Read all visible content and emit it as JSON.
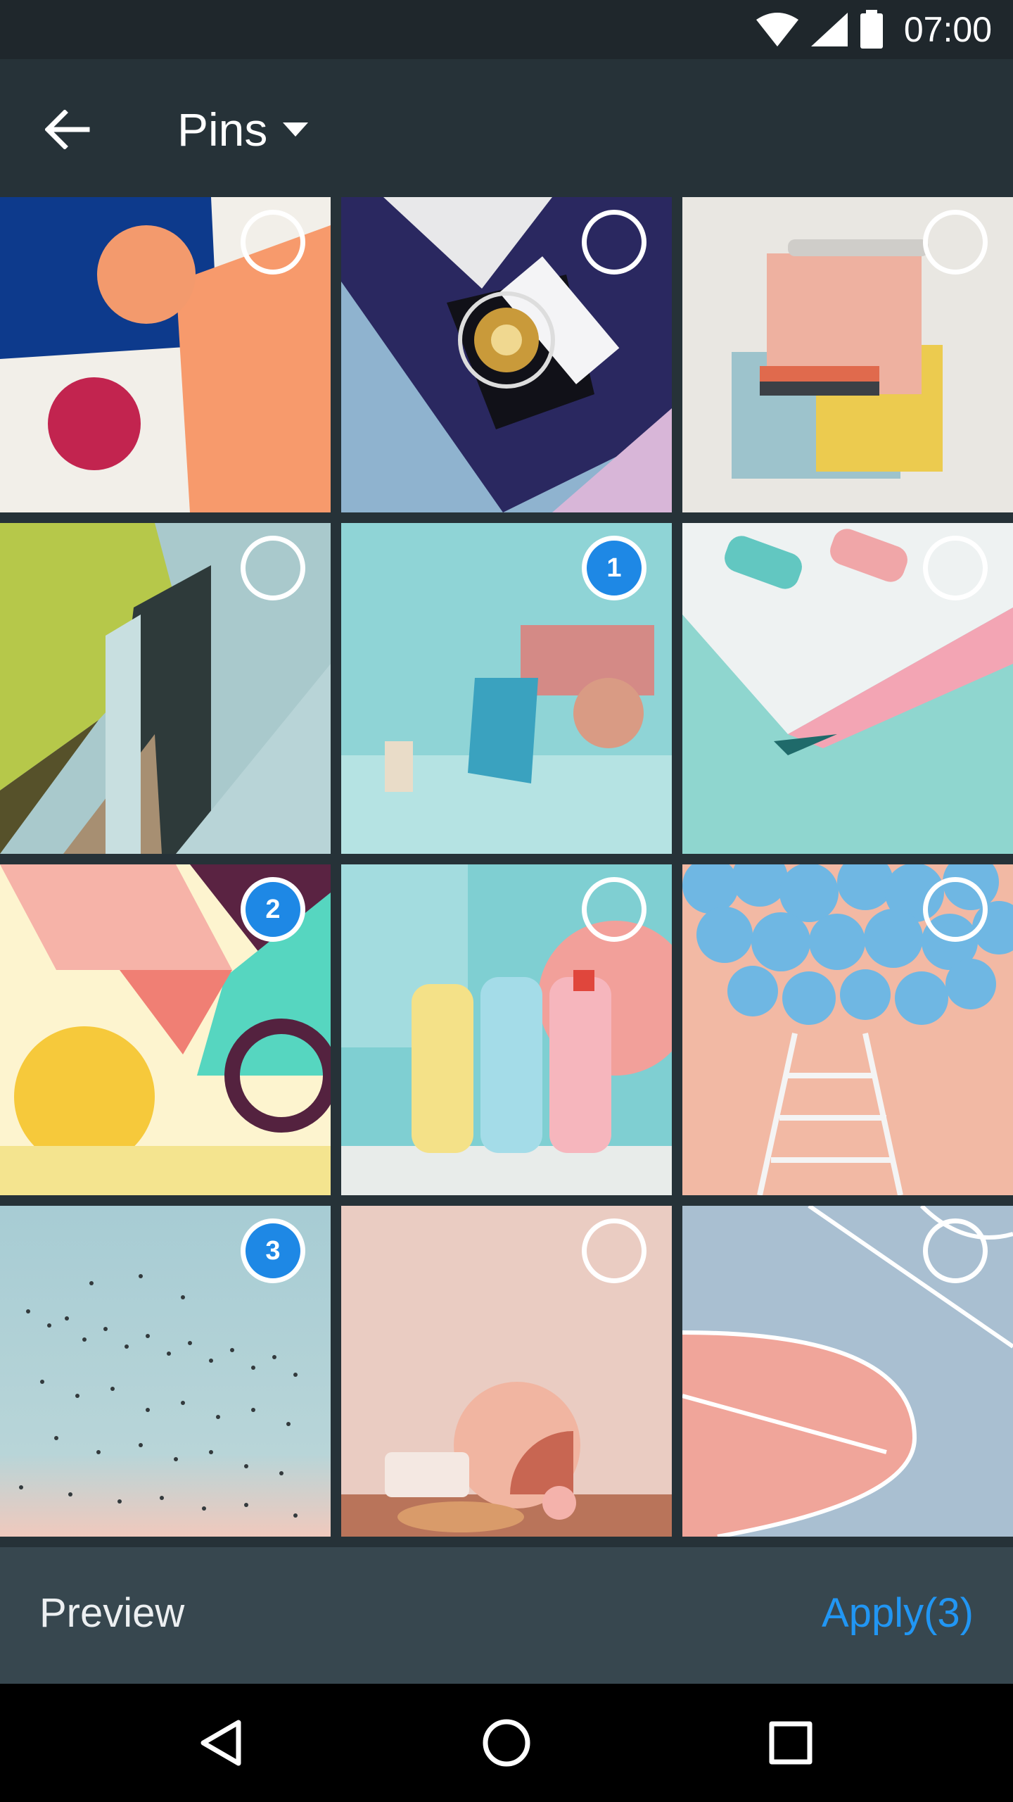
{
  "status_bar": {
    "time": "07:00",
    "icons": [
      "wifi-icon",
      "signal-icon",
      "battery-icon"
    ]
  },
  "app_bar": {
    "back_icon": "arrow-back-icon",
    "title": "Pins",
    "dropdown_icon": "caret-down-icon"
  },
  "grid": {
    "columns": 3,
    "tiles": [
      {
        "index": 0,
        "selected": false,
        "order": ""
      },
      {
        "index": 1,
        "selected": false,
        "order": ""
      },
      {
        "index": 2,
        "selected": false,
        "order": ""
      },
      {
        "index": 3,
        "selected": false,
        "order": ""
      },
      {
        "index": 4,
        "selected": true,
        "order": "1"
      },
      {
        "index": 5,
        "selected": false,
        "order": ""
      },
      {
        "index": 6,
        "selected": true,
        "order": "2"
      },
      {
        "index": 7,
        "selected": false,
        "order": ""
      },
      {
        "index": 8,
        "selected": false,
        "order": ""
      },
      {
        "index": 9,
        "selected": true,
        "order": "3"
      },
      {
        "index": 10,
        "selected": false,
        "order": ""
      },
      {
        "index": 11,
        "selected": false,
        "order": ""
      }
    ]
  },
  "action_bar": {
    "preview_label": "Preview",
    "apply_label": "Apply(3)"
  },
  "nav_bar": {
    "icons": [
      "back-triangle-icon",
      "home-circle-icon",
      "recents-square-icon"
    ]
  },
  "colors": {
    "app_bar_bg": "#263238",
    "status_bar_bg": "#1f272c",
    "action_bar_bg": "#37474f",
    "accent": "#2196f3",
    "selected_badge": "#1e88e5"
  }
}
